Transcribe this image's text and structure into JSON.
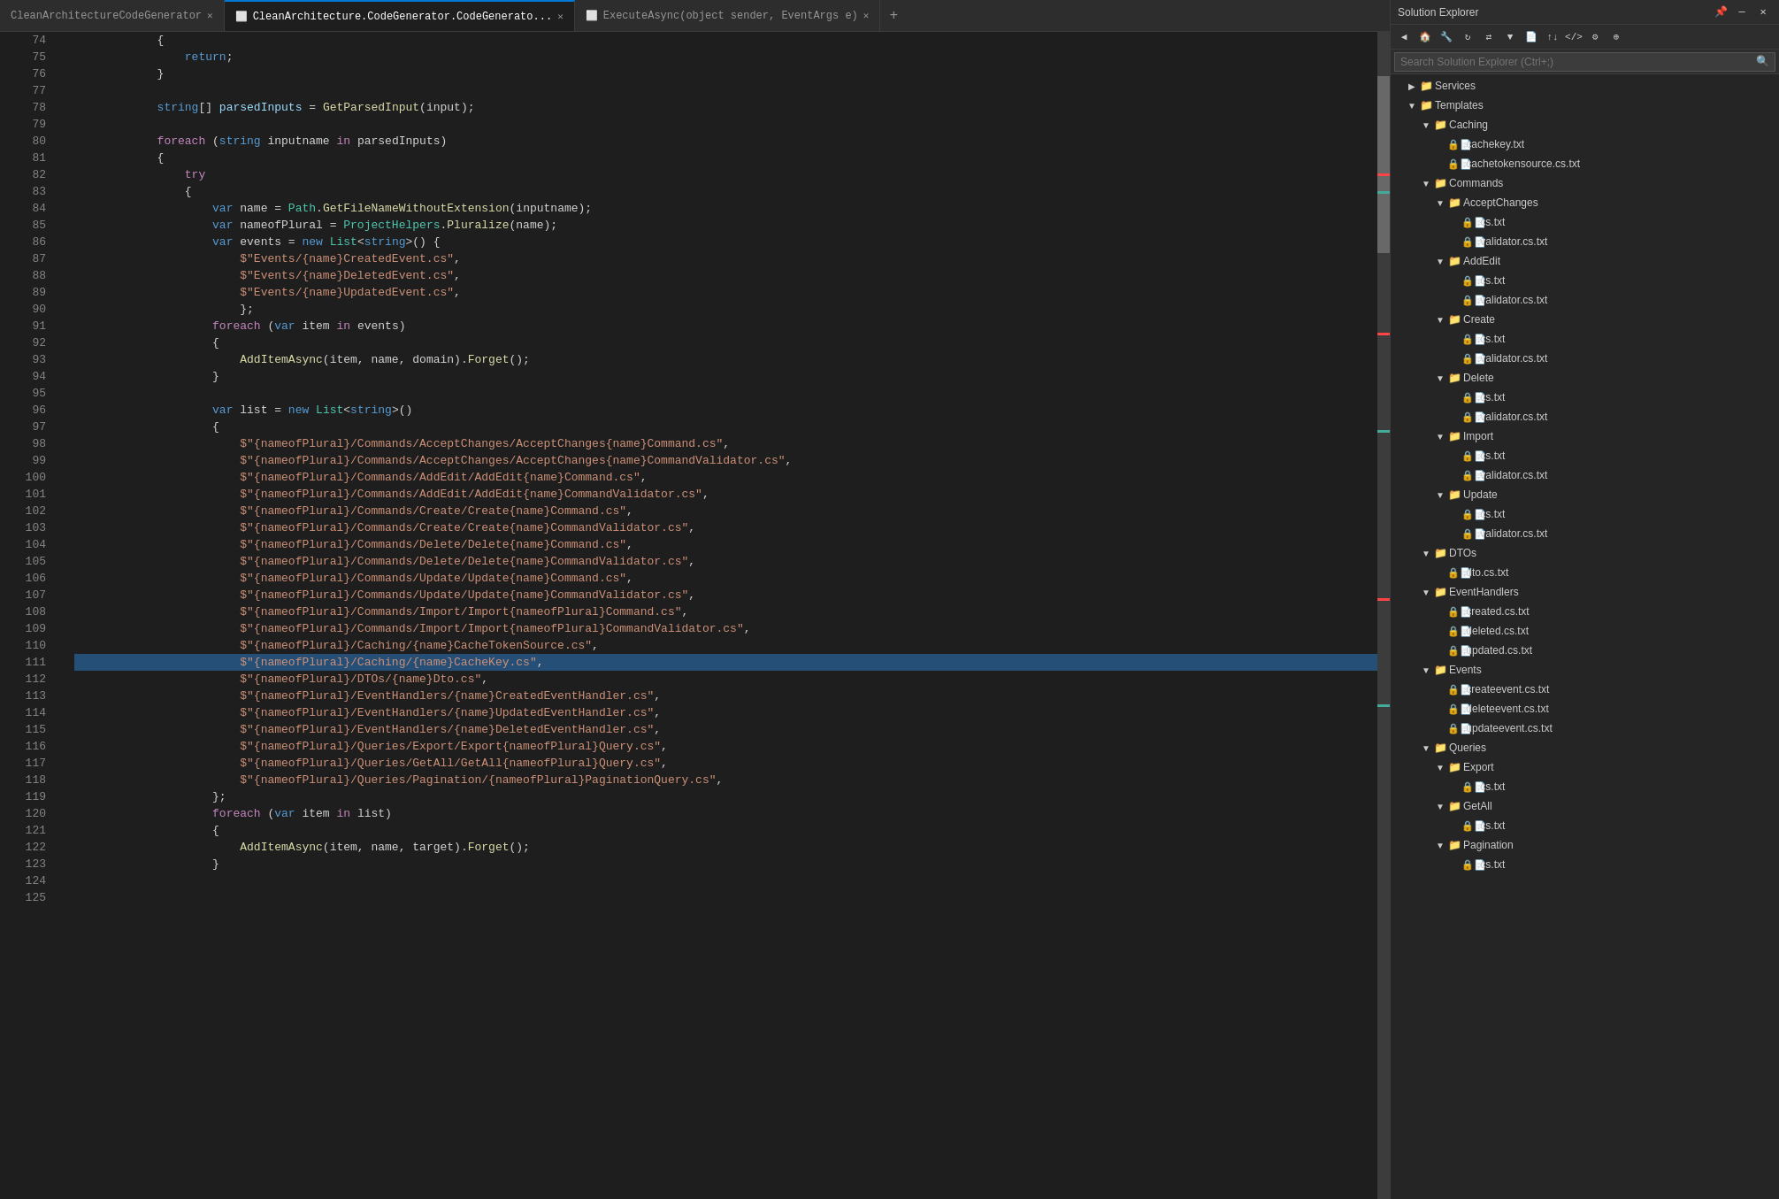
{
  "tabs": [
    {
      "label": "CleanArchitectureCodeGenerator",
      "active": false
    },
    {
      "label": "CleanArchitecture.CodeGenerator.CodeGenerato...",
      "active": true
    },
    {
      "label": "ExecuteAsync(object sender, EventArgs e)",
      "active": false
    }
  ],
  "lines": [
    {
      "num": 74,
      "tokens": [
        {
          "t": "plain",
          "v": "            {"
        }
      ]
    },
    {
      "num": 75,
      "tokens": [
        {
          "t": "kw",
          "v": "                return"
        },
        {
          "t": "plain",
          "v": ";"
        }
      ]
    },
    {
      "num": 76,
      "tokens": [
        {
          "t": "plain",
          "v": "            }"
        }
      ]
    },
    {
      "num": 77,
      "tokens": []
    },
    {
      "num": 78,
      "tokens": [
        {
          "t": "kw",
          "v": "            string"
        },
        {
          "t": "plain",
          "v": "[] "
        },
        {
          "t": "var-name",
          "v": "parsedInputs"
        },
        {
          "t": "plain",
          "v": " = "
        },
        {
          "t": "method",
          "v": "GetParsedInput"
        },
        {
          "t": "plain",
          "v": "(input);"
        }
      ]
    },
    {
      "num": 79,
      "tokens": []
    },
    {
      "num": 80,
      "tokens": [
        {
          "t": "kw2",
          "v": "            foreach"
        },
        {
          "t": "plain",
          "v": " ("
        },
        {
          "t": "kw",
          "v": "string"
        },
        {
          "t": "plain",
          "v": " inputname "
        },
        {
          "t": "kw2",
          "v": "in"
        },
        {
          "t": "plain",
          "v": " parsedInputs)"
        }
      ],
      "breakpoint": true
    },
    {
      "num": 81,
      "tokens": [
        {
          "t": "plain",
          "v": "            {"
        }
      ]
    },
    {
      "num": 82,
      "tokens": [
        {
          "t": "kw2",
          "v": "                try"
        }
      ],
      "collapse": true
    },
    {
      "num": 83,
      "tokens": [
        {
          "t": "plain",
          "v": "                {"
        }
      ]
    },
    {
      "num": 84,
      "tokens": [
        {
          "t": "kw",
          "v": "                    var"
        },
        {
          "t": "plain",
          "v": " name = "
        },
        {
          "t": "type",
          "v": "Path"
        },
        {
          "t": "plain",
          "v": "."
        },
        {
          "t": "method",
          "v": "GetFileNameWithoutExtension"
        },
        {
          "t": "plain",
          "v": "(inputname);"
        }
      ]
    },
    {
      "num": 85,
      "tokens": [
        {
          "t": "kw",
          "v": "                    var"
        },
        {
          "t": "plain",
          "v": " nameofPlural = "
        },
        {
          "t": "type",
          "v": "ProjectHelpers"
        },
        {
          "t": "plain",
          "v": "."
        },
        {
          "t": "method",
          "v": "Pluralize"
        },
        {
          "t": "plain",
          "v": "(name);"
        }
      ]
    },
    {
      "num": 86,
      "tokens": [
        {
          "t": "kw",
          "v": "                    var"
        },
        {
          "t": "plain",
          "v": " events = "
        },
        {
          "t": "kw",
          "v": "new"
        },
        {
          "t": "plain",
          "v": " "
        },
        {
          "t": "type",
          "v": "List"
        },
        {
          "t": "plain",
          "v": "<"
        },
        {
          "t": "kw",
          "v": "string"
        },
        {
          "t": "plain",
          "v": ">() {"
        }
      ],
      "collapse": true
    },
    {
      "num": 87,
      "tokens": [
        {
          "t": "str",
          "v": "                        $\"Events/{name}CreatedEvent.cs\""
        },
        {
          "t": "plain",
          "v": ","
        }
      ]
    },
    {
      "num": 88,
      "tokens": [
        {
          "t": "str",
          "v": "                        $\"Events/{name}DeletedEvent.cs\""
        },
        {
          "t": "plain",
          "v": ","
        }
      ]
    },
    {
      "num": 89,
      "tokens": [
        {
          "t": "str",
          "v": "                        $\"Events/{name}UpdatedEvent.cs\""
        },
        {
          "t": "plain",
          "v": ","
        }
      ]
    },
    {
      "num": 90,
      "tokens": [
        {
          "t": "plain",
          "v": "                        };"
        }
      ]
    },
    {
      "num": 91,
      "tokens": [
        {
          "t": "kw2",
          "v": "                    foreach"
        },
        {
          "t": "plain",
          "v": " ("
        },
        {
          "t": "kw",
          "v": "var"
        },
        {
          "t": "plain",
          "v": " item "
        },
        {
          "t": "kw2",
          "v": "in"
        },
        {
          "t": "plain",
          "v": " events)"
        }
      ]
    },
    {
      "num": 92,
      "tokens": [
        {
          "t": "plain",
          "v": "                    {"
        }
      ]
    },
    {
      "num": 93,
      "tokens": [
        {
          "t": "plain",
          "v": "                        "
        },
        {
          "t": "method",
          "v": "AddItemAsync"
        },
        {
          "t": "plain",
          "v": "(item, name, domain)."
        },
        {
          "t": "method",
          "v": "Forget"
        },
        {
          "t": "plain",
          "v": "();"
        }
      ]
    },
    {
      "num": 94,
      "tokens": [
        {
          "t": "plain",
          "v": "                    }"
        }
      ]
    },
    {
      "num": 95,
      "tokens": []
    },
    {
      "num": 96,
      "tokens": [
        {
          "t": "kw",
          "v": "                    var"
        },
        {
          "t": "plain",
          "v": " list = "
        },
        {
          "t": "kw",
          "v": "new"
        },
        {
          "t": "plain",
          "v": " "
        },
        {
          "t": "type",
          "v": "List"
        },
        {
          "t": "plain",
          "v": "<"
        },
        {
          "t": "kw",
          "v": "string"
        },
        {
          "t": "plain",
          "v": ">()"
        }
      ]
    },
    {
      "num": 97,
      "tokens": [
        {
          "t": "plain",
          "v": "                    {"
        }
      ]
    },
    {
      "num": 98,
      "tokens": [
        {
          "t": "str",
          "v": "                        $\"{nameofPlural}/Commands/AcceptChanges/AcceptChanges{name}Command.cs\""
        },
        {
          "t": "plain",
          "v": ","
        }
      ]
    },
    {
      "num": 99,
      "tokens": [
        {
          "t": "str",
          "v": "                        $\"{nameofPlural}/Commands/AcceptChanges/AcceptChanges{name}CommandValidator.cs\""
        },
        {
          "t": "plain",
          "v": ","
        }
      ]
    },
    {
      "num": 100,
      "tokens": [
        {
          "t": "str",
          "v": "                        $\"{nameofPlural}/Commands/AddEdit/AddEdit{name}Command.cs\""
        },
        {
          "t": "plain",
          "v": ","
        }
      ]
    },
    {
      "num": 101,
      "tokens": [
        {
          "t": "str",
          "v": "                        $\"{nameofPlural}/Commands/AddEdit/AddEdit{name}CommandValidator.cs\""
        },
        {
          "t": "plain",
          "v": ","
        }
      ]
    },
    {
      "num": 102,
      "tokens": [
        {
          "t": "str",
          "v": "                        $\"{nameofPlural}/Commands/Create/Create{name}Command.cs\""
        },
        {
          "t": "plain",
          "v": ","
        }
      ]
    },
    {
      "num": 103,
      "tokens": [
        {
          "t": "str",
          "v": "                        $\"{nameofPlural}/Commands/Create/Create{name}CommandValidator.cs\""
        },
        {
          "t": "plain",
          "v": ","
        }
      ]
    },
    {
      "num": 104,
      "tokens": [
        {
          "t": "str",
          "v": "                        $\"{nameofPlural}/Commands/Delete/Delete{name}Command.cs\""
        },
        {
          "t": "plain",
          "v": ","
        }
      ]
    },
    {
      "num": 105,
      "tokens": [
        {
          "t": "str",
          "v": "                        $\"{nameofPlural}/Commands/Delete/Delete{name}CommandValidator.cs\""
        },
        {
          "t": "plain",
          "v": ","
        }
      ]
    },
    {
      "num": 106,
      "tokens": [
        {
          "t": "str",
          "v": "                        $\"{nameofPlural}/Commands/Update/Update{name}Command.cs\""
        },
        {
          "t": "plain",
          "v": ","
        }
      ]
    },
    {
      "num": 107,
      "tokens": [
        {
          "t": "str",
          "v": "                        $\"{nameofPlural}/Commands/Update/Update{name}CommandValidator.cs\""
        },
        {
          "t": "plain",
          "v": ","
        }
      ]
    },
    {
      "num": 108,
      "tokens": [
        {
          "t": "str",
          "v": "                        $\"{nameofPlural}/Commands/Import/Import{nameofPlural}Command.cs\""
        },
        {
          "t": "plain",
          "v": ","
        }
      ]
    },
    {
      "num": 109,
      "tokens": [
        {
          "t": "str",
          "v": "                        $\"{nameofPlural}/Commands/Import/Import{nameofPlural}CommandValidator.cs\""
        },
        {
          "t": "plain",
          "v": ","
        }
      ]
    },
    {
      "num": 110,
      "tokens": [
        {
          "t": "str",
          "v": "                        $\"{nameofPlural}/Caching/{name}CacheTokenSource.cs\""
        },
        {
          "t": "plain",
          "v": ","
        }
      ]
    },
    {
      "num": 111,
      "tokens": [
        {
          "t": "str",
          "v": "                        $\"{nameofPlural}/Caching/{name}CacheKey.cs\""
        },
        {
          "t": "plain",
          "v": ","
        }
      ],
      "highlighted": true
    },
    {
      "num": 112,
      "tokens": [
        {
          "t": "str",
          "v": "                        $\"{nameofPlural}/DTOs/{name}Dto.cs\""
        },
        {
          "t": "plain",
          "v": ","
        }
      ]
    },
    {
      "num": 113,
      "tokens": [
        {
          "t": "str",
          "v": "                        $\"{nameofPlural}/EventHandlers/{name}CreatedEventHandler.cs\""
        },
        {
          "t": "plain",
          "v": ","
        }
      ]
    },
    {
      "num": 114,
      "tokens": [
        {
          "t": "str",
          "v": "                        $\"{nameofPlural}/EventHandlers/{name}UpdatedEventHandler.cs\""
        },
        {
          "t": "plain",
          "v": ","
        }
      ]
    },
    {
      "num": 115,
      "tokens": [
        {
          "t": "str",
          "v": "                        $\"{nameofPlural}/EventHandlers/{name}DeletedEventHandler.cs\""
        },
        {
          "t": "plain",
          "v": ","
        }
      ]
    },
    {
      "num": 116,
      "tokens": [
        {
          "t": "str",
          "v": "                        $\"{nameofPlural}/Queries/Export/Export{nameofPlural}Query.cs\""
        },
        {
          "t": "plain",
          "v": ","
        }
      ]
    },
    {
      "num": 117,
      "tokens": [
        {
          "t": "str",
          "v": "                        $\"{nameofPlural}/Queries/GetAll/GetAll{nameofPlural}Query.cs\""
        },
        {
          "t": "plain",
          "v": ","
        }
      ]
    },
    {
      "num": 118,
      "tokens": [
        {
          "t": "str",
          "v": "                        $\"{nameofPlural}/Queries/Pagination/{nameofPlural}PaginationQuery.cs\""
        },
        {
          "t": "plain",
          "v": ","
        }
      ]
    },
    {
      "num": 119,
      "tokens": [
        {
          "t": "plain",
          "v": "                    };"
        }
      ]
    },
    {
      "num": 120,
      "tokens": [
        {
          "t": "kw2",
          "v": "                    foreach"
        },
        {
          "t": "plain",
          "v": " ("
        },
        {
          "t": "kw",
          "v": "var"
        },
        {
          "t": "plain",
          "v": " item "
        },
        {
          "t": "kw2",
          "v": "in"
        },
        {
          "t": "plain",
          "v": " list)"
        }
      ],
      "collapse": true
    },
    {
      "num": 121,
      "tokens": [
        {
          "t": "plain",
          "v": "                    {"
        }
      ]
    },
    {
      "num": 122,
      "tokens": [
        {
          "t": "plain",
          "v": "                        "
        },
        {
          "t": "method",
          "v": "AddItemAsync"
        },
        {
          "t": "plain",
          "v": "(item, name, target)."
        },
        {
          "t": "method",
          "v": "Forget"
        },
        {
          "t": "plain",
          "v": "();"
        }
      ]
    },
    {
      "num": 123,
      "tokens": [
        {
          "t": "plain",
          "v": "                    }"
        }
      ]
    },
    {
      "num": 124,
      "tokens": []
    },
    {
      "num": 125,
      "tokens": []
    }
  ],
  "solution": {
    "title": "Solution Explorer",
    "search_placeholder": "Search Solution Explorer (Ctrl+;)",
    "tree": [
      {
        "indent": 1,
        "type": "folder",
        "collapsed": true,
        "label": "Services"
      },
      {
        "indent": 1,
        "type": "folder",
        "expanded": true,
        "label": "Templates"
      },
      {
        "indent": 2,
        "type": "folder",
        "expanded": true,
        "label": "Caching"
      },
      {
        "indent": 3,
        "type": "file",
        "label": ".cachekey.txt"
      },
      {
        "indent": 3,
        "type": "file",
        "label": ".cachetokensource.cs.txt"
      },
      {
        "indent": 2,
        "type": "folder",
        "expanded": true,
        "label": "Commands"
      },
      {
        "indent": 3,
        "type": "folder",
        "expanded": true,
        "label": "AcceptChanges"
      },
      {
        "indent": 4,
        "type": "file",
        "label": ".cs.txt"
      },
      {
        "indent": 4,
        "type": "file",
        "label": ".validator.cs.txt"
      },
      {
        "indent": 3,
        "type": "folder",
        "expanded": true,
        "label": "AddEdit"
      },
      {
        "indent": 4,
        "type": "file",
        "label": ".cs.txt"
      },
      {
        "indent": 4,
        "type": "file",
        "label": ".validator.cs.txt"
      },
      {
        "indent": 3,
        "type": "folder",
        "expanded": true,
        "label": "Create"
      },
      {
        "indent": 4,
        "type": "file",
        "label": ".cs.txt"
      },
      {
        "indent": 4,
        "type": "file",
        "label": ".validator.cs.txt"
      },
      {
        "indent": 3,
        "type": "folder",
        "expanded": true,
        "label": "Delete"
      },
      {
        "indent": 4,
        "type": "file",
        "label": ".cs.txt"
      },
      {
        "indent": 4,
        "type": "file",
        "label": ".validator.cs.txt"
      },
      {
        "indent": 3,
        "type": "folder",
        "expanded": true,
        "label": "Import"
      },
      {
        "indent": 4,
        "type": "file",
        "label": ".cs.txt"
      },
      {
        "indent": 4,
        "type": "file",
        "label": ".validator.cs.txt"
      },
      {
        "indent": 3,
        "type": "folder",
        "expanded": true,
        "label": "Update"
      },
      {
        "indent": 4,
        "type": "file",
        "label": ".cs.txt"
      },
      {
        "indent": 4,
        "type": "file",
        "label": ".validator.cs.txt"
      },
      {
        "indent": 2,
        "type": "folder",
        "expanded": true,
        "label": "DTOs"
      },
      {
        "indent": 3,
        "type": "file",
        "label": ".dto.cs.txt"
      },
      {
        "indent": 2,
        "type": "folder",
        "expanded": true,
        "label": "EventHandlers"
      },
      {
        "indent": 3,
        "type": "file",
        "label": ".created.cs.txt"
      },
      {
        "indent": 3,
        "type": "file",
        "label": ".deleted.cs.txt"
      },
      {
        "indent": 3,
        "type": "file",
        "label": ".updated.cs.txt"
      },
      {
        "indent": 2,
        "type": "folder",
        "expanded": true,
        "label": "Events"
      },
      {
        "indent": 3,
        "type": "file",
        "label": ".createevent.cs.txt"
      },
      {
        "indent": 3,
        "type": "file",
        "label": ".deleteevent.cs.txt"
      },
      {
        "indent": 3,
        "type": "file",
        "label": ".updateevent.cs.txt"
      },
      {
        "indent": 2,
        "type": "folder",
        "expanded": true,
        "label": "Queries"
      },
      {
        "indent": 3,
        "type": "folder",
        "expanded": true,
        "label": "Export"
      },
      {
        "indent": 4,
        "type": "file",
        "label": ".cs.txt"
      },
      {
        "indent": 3,
        "type": "folder",
        "expanded": true,
        "label": "GetAll"
      },
      {
        "indent": 4,
        "type": "file",
        "label": ".cs.txt"
      },
      {
        "indent": 3,
        "type": "folder",
        "expanded": true,
        "label": "Pagination"
      },
      {
        "indent": 4,
        "type": "file",
        "label": ".cs.txt"
      }
    ]
  }
}
